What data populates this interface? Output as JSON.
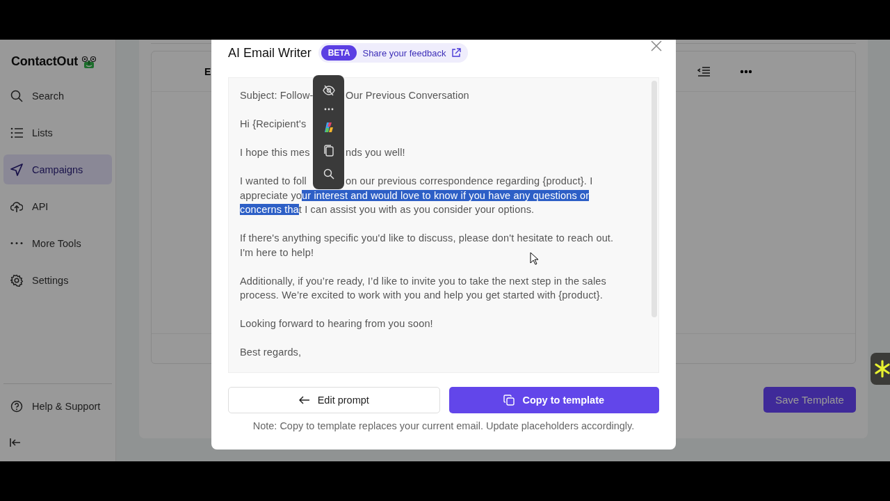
{
  "sidebar": {
    "logo": "ContactOut",
    "items": [
      {
        "label": "Search",
        "selected": false
      },
      {
        "label": "Lists",
        "selected": false
      },
      {
        "label": "Campaigns",
        "selected": true
      },
      {
        "label": "API",
        "selected": false
      },
      {
        "label": "More Tools",
        "selected": false
      },
      {
        "label": "Settings",
        "selected": false
      }
    ],
    "footer_items": [
      {
        "label": "Help & Support"
      }
    ]
  },
  "editor": {
    "heading": "E",
    "save_button": "Save Template"
  },
  "modal": {
    "title": "AI Email Writer",
    "badge": "BETA",
    "feedback_link": "Share your feedback",
    "email": {
      "paragraphs": [
        [
          [
            {
              "text": "Subject: Follow-",
              "selected": false,
              "after_toolbar": false
            },
            {
              "text": "Our Previous Conversation",
              "selected": false,
              "after_toolbar": true
            }
          ]
        ],
        [
          [
            {
              "text": "Hi {Recipient's",
              "selected": false,
              "after_toolbar": false
            }
          ]
        ],
        [
          [
            {
              "text": "I hope this mes",
              "selected": false,
              "after_toolbar": false
            },
            {
              "text": "nds you well!",
              "selected": false,
              "after_toolbar": true
            }
          ]
        ],
        [
          [
            {
              "text": "I wanted to foll",
              "selected": false,
              "after_toolbar": false
            },
            {
              "text": "on our previous correspondence regarding {product}. I",
              "selected": false,
              "after_toolbar": true
            }
          ],
          [
            {
              "text": "appreciate yo",
              "selected": false,
              "after_toolbar": false
            },
            {
              "text": "ur interest and would love to know if you have any questions or",
              "selected": true,
              "after_toolbar": false
            }
          ],
          [
            {
              "text": "concerns tha",
              "selected": true,
              "after_toolbar": false
            },
            {
              "text": "t I can assist you with as you consider your options.",
              "selected": false,
              "after_toolbar": false
            }
          ]
        ],
        [
          [
            {
              "text": "If there's anything specific you'd like to discuss, please don't hesitate to reach out.",
              "selected": false,
              "after_toolbar": false
            }
          ],
          [
            {
              "text": "I'm here to help!",
              "selected": false,
              "after_toolbar": false
            }
          ]
        ],
        [
          [
            {
              "text": "Additionally, if you’re ready, I’d like to invite you to take the next step in the sales",
              "selected": false,
              "after_toolbar": false
            }
          ],
          [
            {
              "text": "process. We’re excited to work with you and help you get started with {product}.",
              "selected": false,
              "after_toolbar": false
            }
          ]
        ],
        [
          [
            {
              "text": "Looking forward to hearing from you soon!",
              "selected": false,
              "after_toolbar": false
            }
          ]
        ],
        [
          [
            {
              "text": "Best regards,",
              "selected": false,
              "after_toolbar": false
            }
          ]
        ]
      ]
    },
    "edit_button": "Edit prompt",
    "copy_button": "Copy to template",
    "note": "Note: Copy to template replaces your current email. Update placeholders accordingly."
  }
}
